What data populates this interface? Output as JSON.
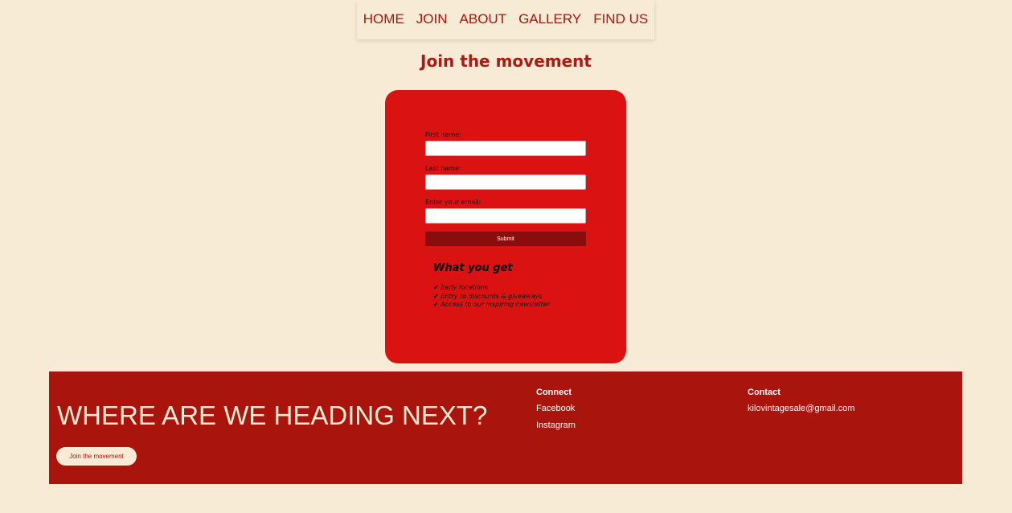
{
  "nav": {
    "items": [
      "HOME",
      "JOIN",
      "ABOUT",
      "GALLERY",
      "FIND US"
    ]
  },
  "page_title": "Join the movement",
  "form": {
    "first_name_label": "First name:",
    "last_name_label": "Last name:",
    "email_label": "Enter your email:",
    "first_name_value": "",
    "last_name_value": "",
    "email_value": "",
    "submit_label": "Submit"
  },
  "benefits": {
    "title": "What you get",
    "items": [
      "✔ Early locations",
      "✔ Entry to discounts & giveaways",
      "✔ Access to our inspiring newsletter"
    ]
  },
  "footer": {
    "heading": "WHERE ARE WE HEADING NEXT?",
    "button_label": "Join the movement",
    "connect": {
      "title": "Connect",
      "links": [
        "Facebook",
        "Instagram"
      ]
    },
    "contact": {
      "title": "Contact",
      "email": "kilovintagesale@gmail.com"
    }
  },
  "colors": {
    "background": "#f7ebd6",
    "brand_red": "#a9140d",
    "card_red": "#db1212",
    "submit_dark": "#8a0d0d"
  }
}
